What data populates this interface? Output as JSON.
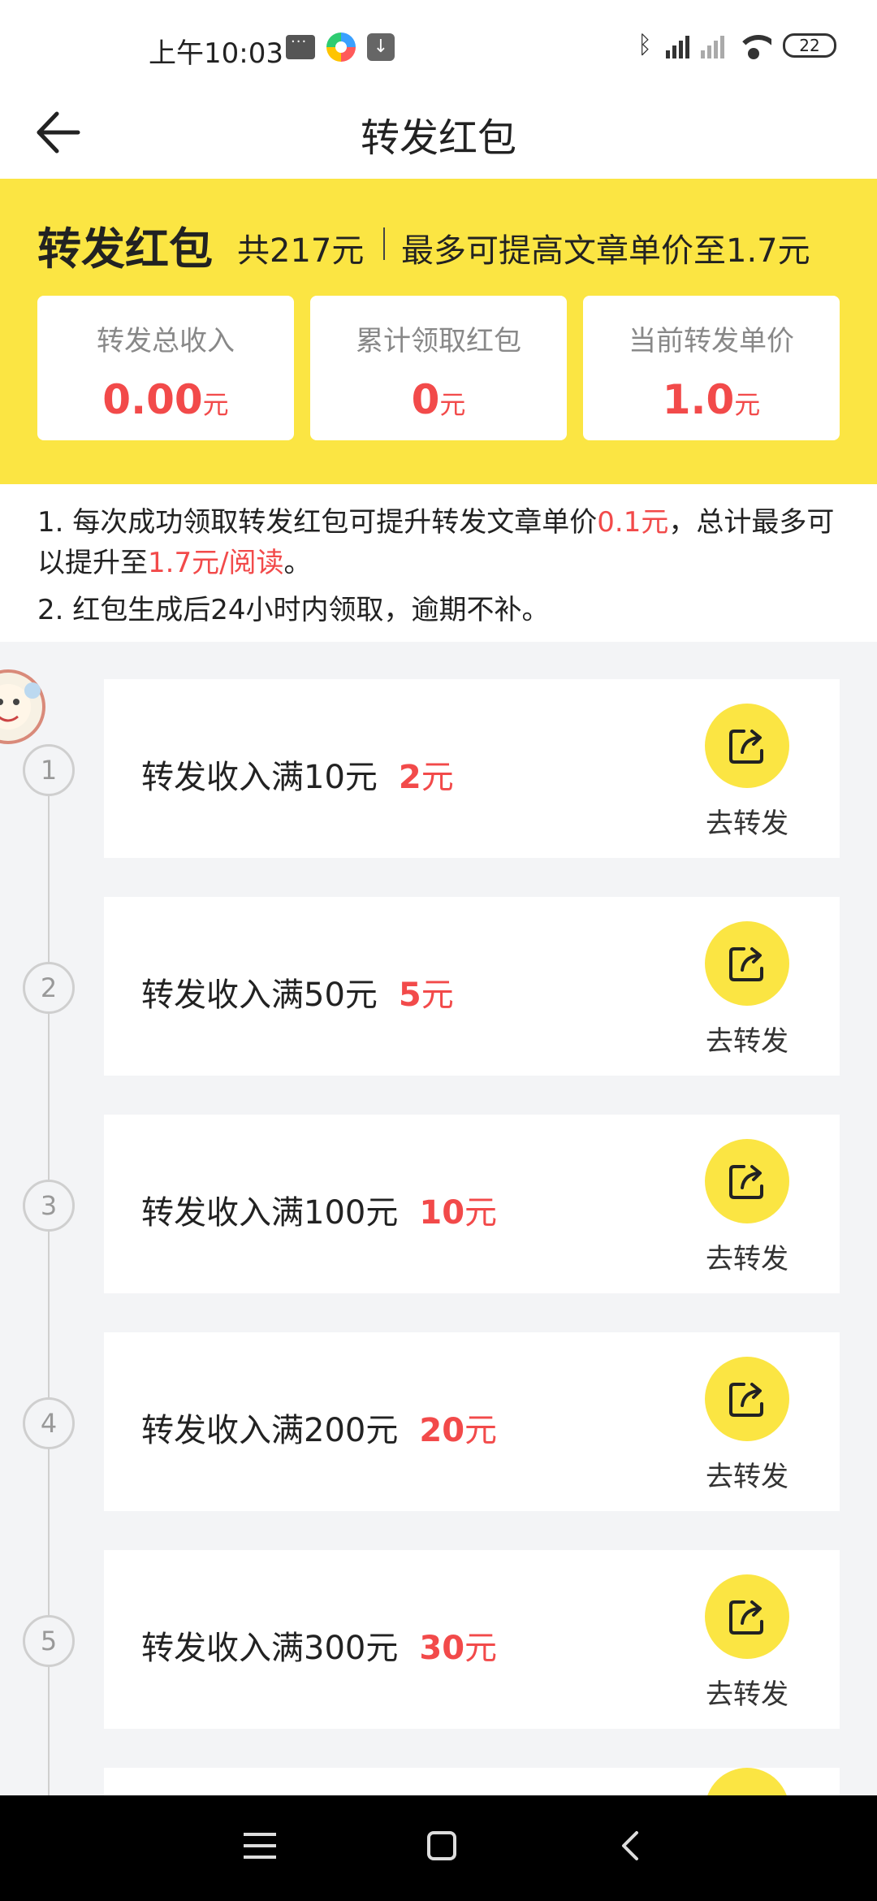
{
  "status_bar": {
    "time": "上午10:03",
    "battery": "22"
  },
  "header": {
    "title": "转发红包"
  },
  "hero": {
    "title": "转发红包",
    "total": "共217元",
    "max_info": "最多可提高文章单价至1.7元",
    "stats": [
      {
        "label": "转发总收入",
        "value": "0.00",
        "unit": "元"
      },
      {
        "label": "累计领取红包",
        "value": "0",
        "unit": "元"
      },
      {
        "label": "当前转发单价",
        "value": "1.0",
        "unit": "元"
      }
    ]
  },
  "rules": {
    "rule1_prefix": "1. 每次成功领取转发红包可提升转发文章单价",
    "rule1_highlight": "0.1元",
    "rule1_middle": "，总计最多可以提升至",
    "rule1_highlight2": "1.7元/阅读",
    "rule1_suffix": "。",
    "rule2": "2. 红包生成后24小时内领取，逾期不补。"
  },
  "tasks": [
    {
      "step": "1",
      "text": "转发收入满10元",
      "reward": "2",
      "unit": "元",
      "action": "去转发"
    },
    {
      "step": "2",
      "text": "转发收入满50元",
      "reward": "5",
      "unit": "元",
      "action": "去转发"
    },
    {
      "step": "3",
      "text": "转发收入满100元",
      "reward": "10",
      "unit": "元",
      "action": "去转发"
    },
    {
      "step": "4",
      "text": "转发收入满200元",
      "reward": "20",
      "unit": "元",
      "action": "去转发"
    },
    {
      "step": "5",
      "text": "转发收入满300元",
      "reward": "30",
      "unit": "元",
      "action": "去转发"
    }
  ],
  "colors": {
    "accent_yellow": "#fbe543",
    "highlight_red": "#f24a4a"
  }
}
